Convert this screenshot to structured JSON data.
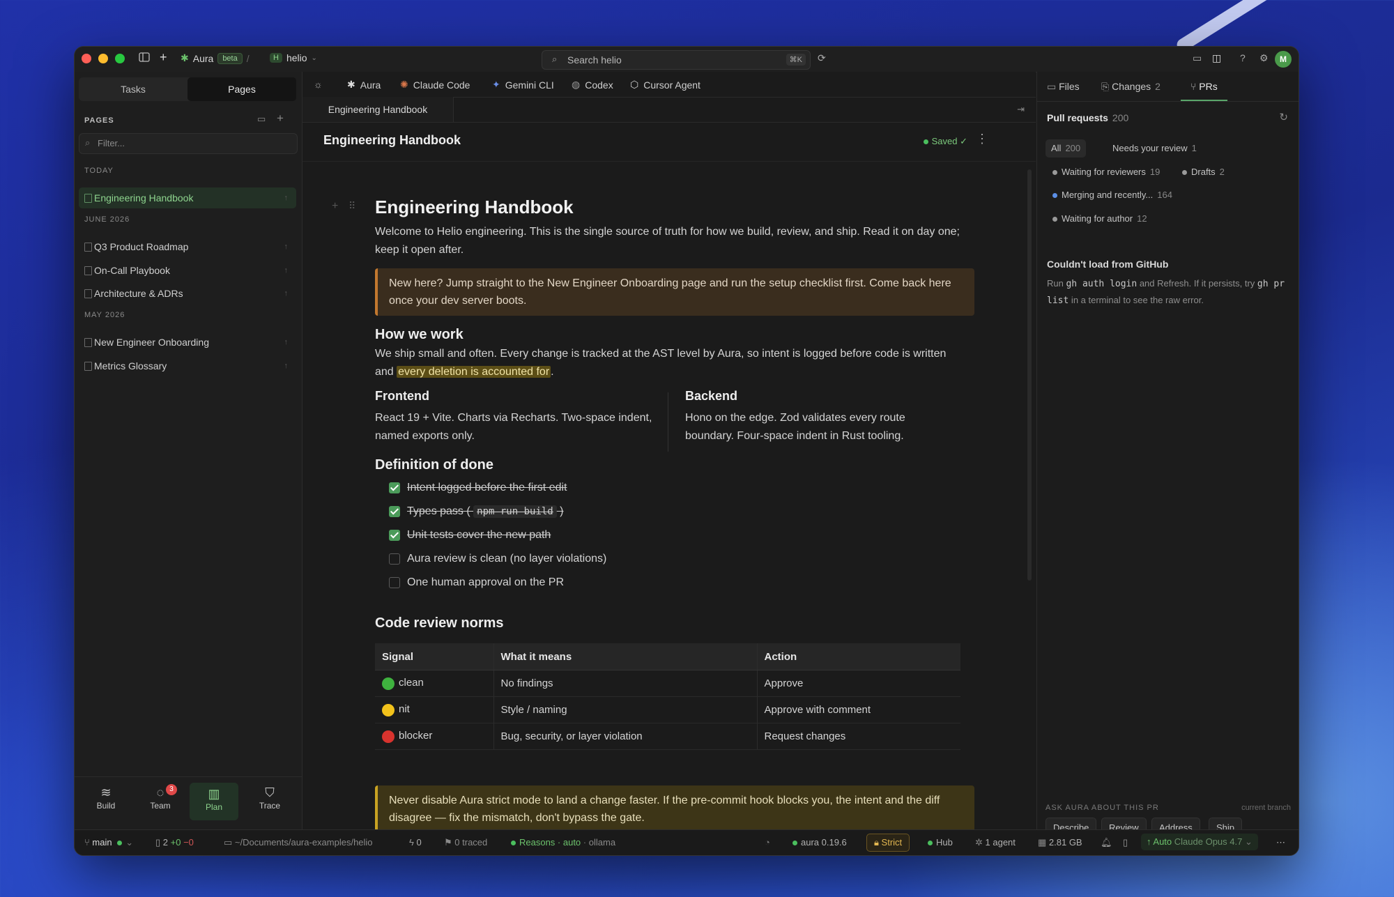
{
  "titlebar": {
    "app_name": "Aura",
    "beta_label": "beta",
    "workspace_initial": "H",
    "workspace": "helio",
    "search_placeholder": "Search helio",
    "search_shortcut": "⌘K",
    "avatar_initial": "M"
  },
  "sidebar": {
    "tabs": [
      "Tasks",
      "Pages"
    ],
    "active_tab": "Pages",
    "section_label": "PAGES",
    "filter_placeholder": "Filter...",
    "groups": [
      {
        "label": "TODAY",
        "items": [
          "Engineering Handbook"
        ]
      },
      {
        "label": "JUNE 2026",
        "items": [
          "Q3 Product Roadmap",
          "On-Call Playbook",
          "Architecture & ADRs"
        ]
      },
      {
        "label": "MAY 2026",
        "items": [
          "New Engineer Onboarding",
          "Metrics Glossary"
        ]
      }
    ],
    "selected_item": "Engineering Handbook",
    "bottom_nav": [
      {
        "label": "Build",
        "icon": "layers-icon"
      },
      {
        "label": "Team",
        "icon": "chat-icon",
        "badge": "3"
      },
      {
        "label": "Plan",
        "icon": "board-icon"
      },
      {
        "label": "Trace",
        "icon": "shield-icon"
      }
    ],
    "active_nav": "Plan"
  },
  "agents": [
    "Aura",
    "Claude Code",
    "Gemini CLI",
    "Codex",
    "Cursor Agent"
  ],
  "document": {
    "tab_title": "Engineering Handbook",
    "header_title": "Engineering Handbook",
    "saved_label": "Saved ✓",
    "title": "Engineering Handbook",
    "intro": "Welcome to Helio engineering. This is the single source of truth for how we build, review, and ship. Read it on day one; keep it open after.",
    "callout_info": "New here? Jump straight to the New Engineer Onboarding page and run the setup checklist first. Come back here once your dev server boots.",
    "how_heading": "How we work",
    "how_text_before": "We ship small and often. Every change is tracked at the AST level by Aura, so intent is logged before code is written and ",
    "how_highlight": "every deletion is accounted for",
    "how_text_after": ".",
    "frontend_heading": "Frontend",
    "frontend_text": "React 19 + Vite. Charts via Recharts. Two-space indent, named exports only.",
    "backend_heading": "Backend",
    "backend_text": "Hono on the edge. Zod validates every route boundary. Four-space indent in Rust tooling.",
    "dod_heading": "Definition of done",
    "todos": [
      {
        "text": "Intent logged before the first edit",
        "done": true
      },
      {
        "text_before": "Types pass ( ",
        "code": "npm run build",
        "text_after": " )",
        "done": true
      },
      {
        "text": "Unit tests cover the new path",
        "done": true
      },
      {
        "text": "Aura review is clean (no layer violations)",
        "done": false
      },
      {
        "text": "One human approval on the PR",
        "done": false
      }
    ],
    "norms_heading": "Code review norms",
    "norms_columns": [
      "Signal",
      "What it means",
      "Action"
    ],
    "norms_rows": [
      {
        "signal": "clean",
        "color": "#3fb23f",
        "meaning": "No findings",
        "action": "Approve"
      },
      {
        "signal": "nit",
        "color": "#f2c21b",
        "meaning": "Style / naming",
        "action": "Approve with comment"
      },
      {
        "signal": "blocker",
        "color": "#d8332e",
        "meaning": "Bug, security, or layer violation",
        "action": "Request changes"
      }
    ],
    "callout_warn": "Never disable Aura strict mode to land a change faster. If the pre-commit hook blocks you, the intent and the diff disagree — fix the mismatch, don't bypass the gate."
  },
  "right_panel": {
    "tabs": [
      {
        "label": "Files",
        "count": ""
      },
      {
        "label": "Changes",
        "count": "2"
      },
      {
        "label": "PRs",
        "count": ""
      }
    ],
    "active_tab": "PRs",
    "pr_title": "Pull requests",
    "pr_count": "200",
    "filters_row1": [
      {
        "label": "All",
        "count": "200"
      },
      {
        "label": "Needs your review",
        "count": "1"
      }
    ],
    "filters": [
      {
        "label": "Waiting for reviewers",
        "count": "19",
        "color": "#9a9a9a"
      },
      {
        "label": "Drafts",
        "count": "2",
        "color": "#9a9a9a"
      },
      {
        "label": "Merging and recently...",
        "count": "164",
        "color": "#5b8fe6"
      },
      {
        "label": "Waiting for author",
        "count": "12",
        "color": "#9a9a9a"
      }
    ],
    "error_title": "Couldn't load from GitHub",
    "error_text_1": "Run ",
    "error_code_1": "gh auth login",
    "error_text_2": " and Refresh. If it persists, try ",
    "error_code_2": "gh pr list",
    "error_text_3": " in a terminal to see the raw error.",
    "ask_label": "ASK AURA ABOUT THIS PR",
    "ask_scope": "current branch",
    "ask_buttons": [
      "Describe",
      "Review",
      "Address",
      "Ship"
    ]
  },
  "statusbar": {
    "branch": "main",
    "files_changed": "2",
    "added": "+0",
    "removed": "−0",
    "path": "~/Documents/aura-examples/helio",
    "bolt_count": "0",
    "traced_count": "0",
    "traced_label": "traced",
    "reasons": "Reasons · auto",
    "model_provider": "ollama",
    "version": "aura 0.19.6",
    "strict": "Strict",
    "hub": "Hub",
    "agents": "1 agent",
    "memory": "2.81 GB",
    "auto_label": "Auto",
    "model": "Claude Opus 4.7"
  }
}
